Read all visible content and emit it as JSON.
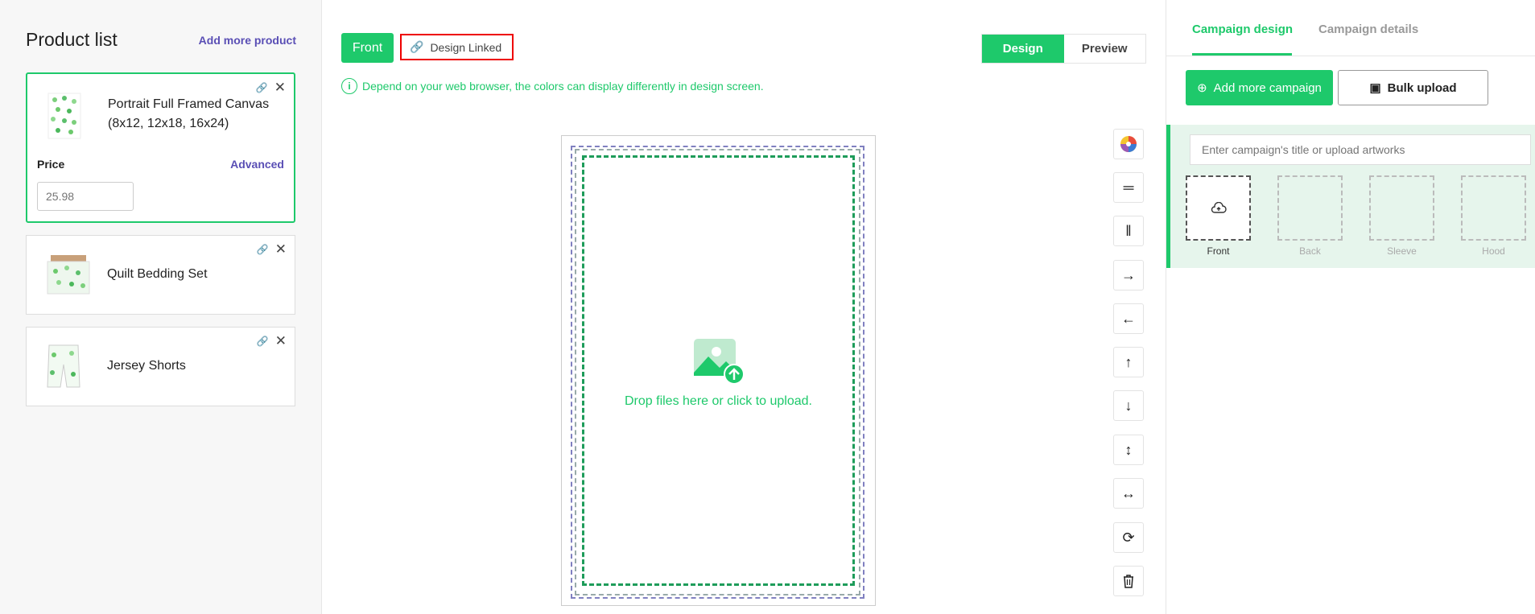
{
  "left": {
    "title": "Product list",
    "add_more": "Add more product",
    "products": [
      {
        "name_line1": "Portrait Full Framed Canvas",
        "name_line2": "(8x12, 12x18, 16x24)",
        "price_label": "Price",
        "advanced": "Advanced",
        "price_placeholder": "25.98"
      },
      {
        "name_line1": "Quilt Bedding Set"
      },
      {
        "name_line1": "Jersey Shorts"
      }
    ]
  },
  "center": {
    "front_tab": "Front",
    "design_linked": "Design Linked",
    "mode_design": "Design",
    "mode_preview": "Preview",
    "notice": "Depend on your web browser, the colors can display differently in design screen.",
    "upload_text": "Drop files here or click to upload.",
    "tools": [
      "color-wheel-icon",
      "align-horizontal-icon",
      "align-vertical-icon",
      "arrow-right-icon",
      "arrow-left-icon",
      "arrow-up-icon",
      "arrow-down-icon",
      "stretch-vertical-icon",
      "stretch-horizontal-icon",
      "rotate-icon",
      "trash-icon"
    ]
  },
  "right": {
    "tab_design": "Campaign design",
    "tab_details": "Campaign details",
    "add_campaign": "Add more campaign",
    "bulk_upload": "Bulk upload",
    "campaign_placeholder": "Enter campaign's title or upload artworks",
    "slots": [
      "Front",
      "Back",
      "Sleeve",
      "Hood"
    ]
  },
  "colors": {
    "accent": "#1ec96b",
    "link": "#5a4fb5",
    "highlight_border": "#ee0000"
  }
}
